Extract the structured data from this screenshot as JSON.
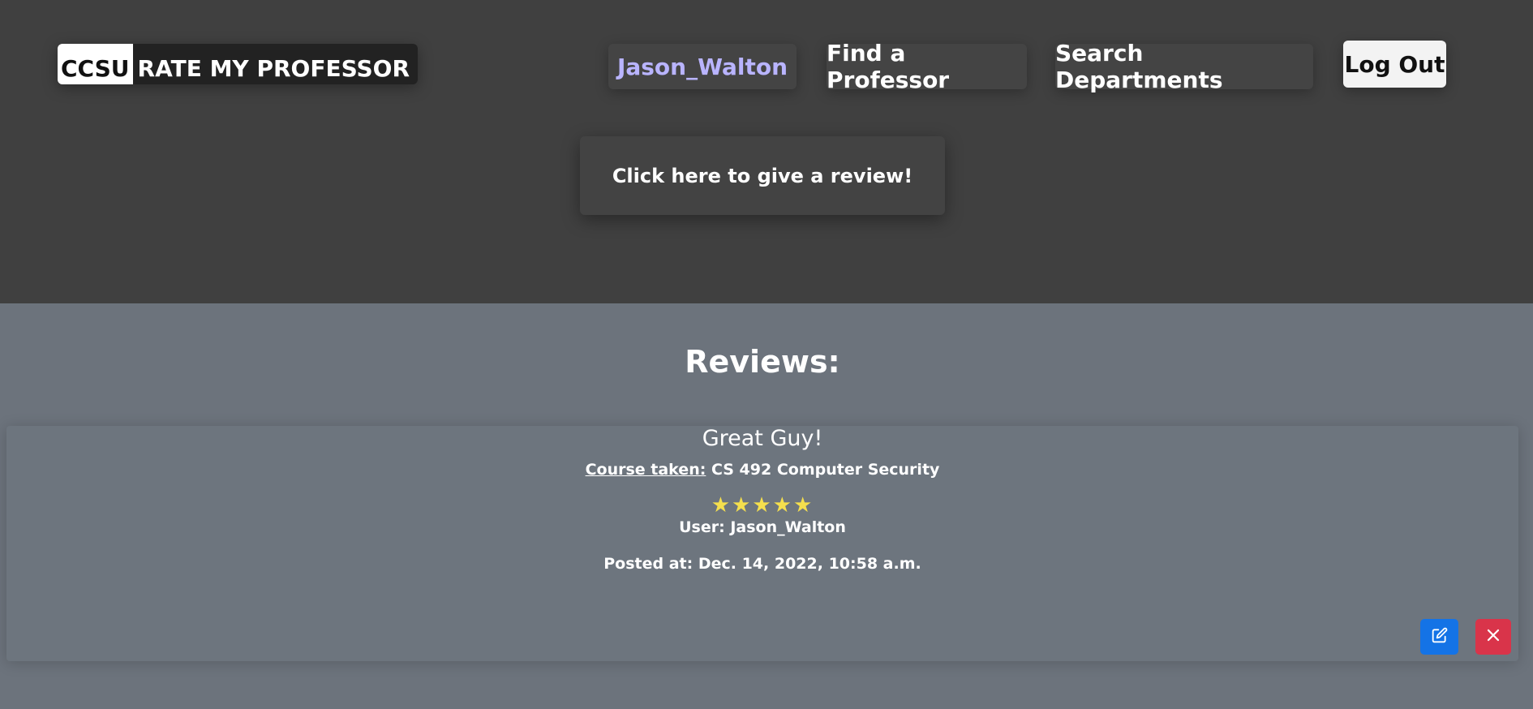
{
  "header": {
    "logo_ccsu": "CCSU",
    "logo_rest": "RATE MY PROFESSOR",
    "nav": {
      "user": "Jason_Walton",
      "find": "Find a Professor",
      "search": "Search Departments",
      "logout": "Log Out"
    },
    "review_cta": "Click here to give a review!"
  },
  "reviews": {
    "heading": "Reviews:",
    "items": [
      {
        "title": "Great Guy!",
        "course_label": "Course taken:",
        "course_value": "CS 492 Computer Security",
        "rating": 5,
        "stars": "★★★★★",
        "user": "User: Jason_Walton",
        "posted": "Posted at: Dec. 14, 2022, 10:58 a.m."
      }
    ]
  },
  "colors": {
    "header_bg": "#404040",
    "page_bg": "#6c737c",
    "user_link": "#b9b4ff",
    "star": "#f5df4d",
    "edit_button": "#1473e6",
    "delete_button": "#d9344a"
  },
  "icons": {
    "edit": "edit-icon",
    "delete": "close-icon",
    "rating": "star-icon"
  }
}
